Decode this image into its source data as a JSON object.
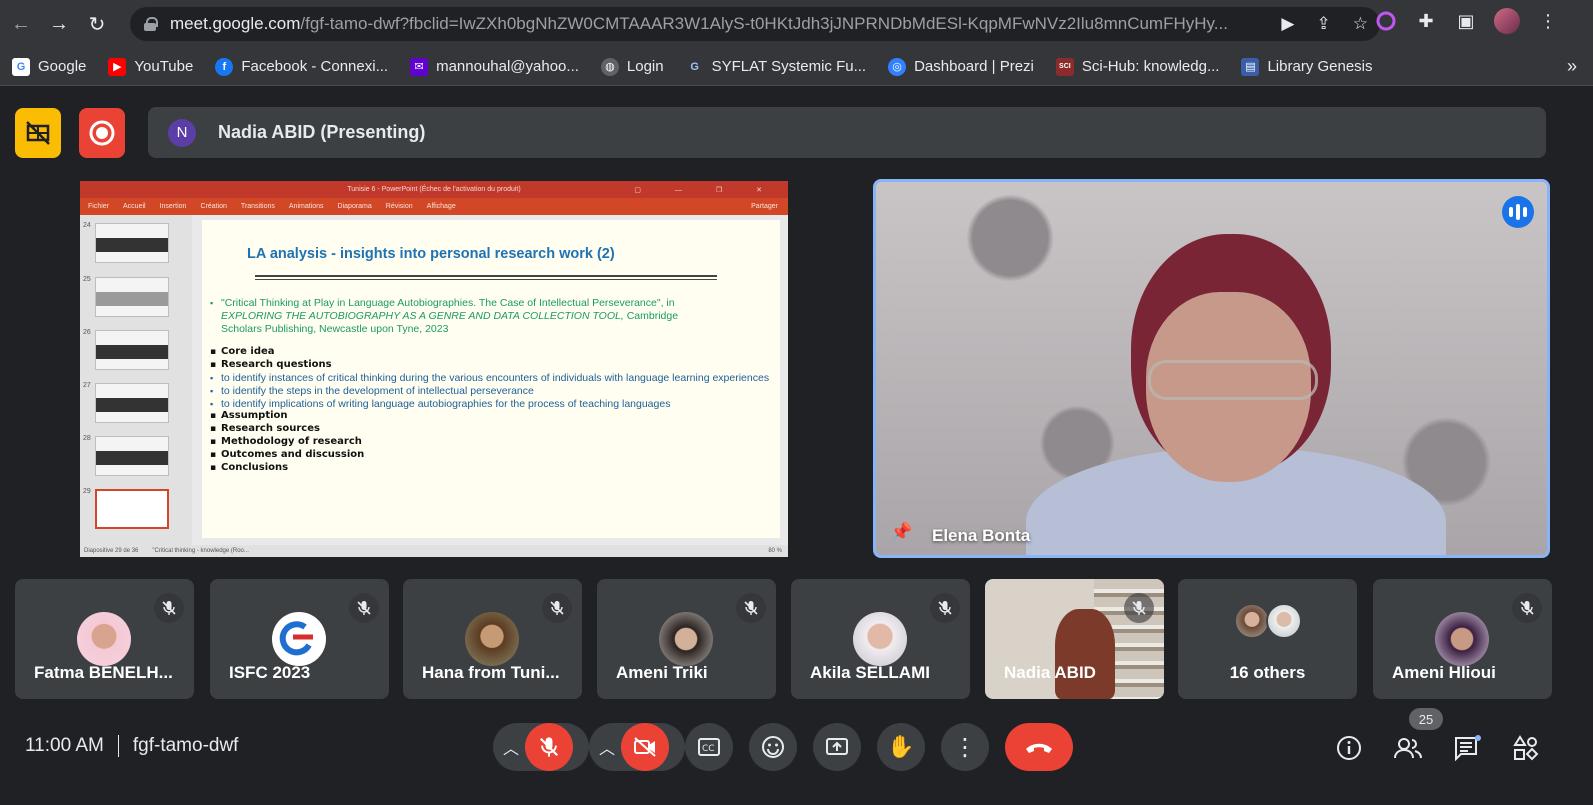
{
  "browser": {
    "url_host": "meet.google.com",
    "url_path": "/fgf-tamo-dwf?fbclid=IwZXh0bgNhZW0CMTAAAR3W1AlyS-t0HKtJdh3jJNPRNDbMdESl-KqpMFwNVz2Ilu8mnCumFHyHy...",
    "bookmarks": [
      {
        "label": "Google",
        "icon": "google-icon",
        "color": "#4285f4"
      },
      {
        "label": "YouTube",
        "icon": "youtube-icon",
        "color": "#ff0000"
      },
      {
        "label": "Facebook - Connexi...",
        "icon": "facebook-icon",
        "color": "#1877f2"
      },
      {
        "label": "mannouhal@yahoo...",
        "icon": "yahoo-mail-icon",
        "color": "#6001d2"
      },
      {
        "label": "Login",
        "icon": "globe-icon",
        "color": "#5f6368"
      },
      {
        "label": "SYFLAT Systemic Fu...",
        "icon": "syflat-icon",
        "color": "#5f6368"
      },
      {
        "label": "Dashboard | Prezi",
        "icon": "prezi-icon",
        "color": "#3181ff"
      },
      {
        "label": "Sci-Hub: knowledg...",
        "icon": "scihub-icon",
        "color": "#8b2b2b"
      },
      {
        "label": "Library Genesis",
        "icon": "library-icon",
        "color": "#3a5fa8"
      }
    ]
  },
  "meet": {
    "presenting_initial": "N",
    "presenting_label": "Nadia ABID (Presenting)",
    "speaker_name": "Elena Bonta",
    "meeting_code": "fgf-tamo-dwf",
    "time": "11:00 AM",
    "participant_count": "25",
    "participants": [
      {
        "name": "Fatma BENELH..."
      },
      {
        "name": "ISFC 2023"
      },
      {
        "name": "Hana from Tuni..."
      },
      {
        "name": "Ameni Triki"
      },
      {
        "name": "Akila SELLAMI"
      },
      {
        "name": "Nadia ABID"
      },
      {
        "name": "16 others"
      },
      {
        "name": "Ameni Hlioui"
      }
    ]
  },
  "slide": {
    "window_title": "Tunisie 6 - PowerPoint (Échec de l'activation du produit)",
    "ribbon_tabs": [
      "Fichier",
      "Accueil",
      "Insertion",
      "Création",
      "Transitions",
      "Animations",
      "Diaporama",
      "Révision",
      "Affichage"
    ],
    "share_label": "Partager",
    "thumb_numbers": [
      "24",
      "25",
      "26",
      "27",
      "28",
      "29"
    ],
    "title": "LA analysis  - insights into personal research work  (2)",
    "citation_line1": "\"Critical Thinking at Play in Language Autobiographies. The Case of Intellectual Perseverance\", in",
    "citation_line2": "EXPLORING THE AUTOBIOGRAPHY AS A GENRE AND DATA COLLECTION TOOL,",
    "citation_line2b": " Cambridge",
    "citation_line3": "Scholars Publishing, Newcastle upon Tyne, 2023",
    "core_idea": "Core idea",
    "research_questions": "Research questions",
    "q1": "to identify instances of critical thinking during the various encounters of individuals with language learning experiences",
    "q2": "to identify the steps in the development of intellectual perseverance",
    "q3": "to identify implications of writing language autobiographies for the process of teaching languages",
    "assumption": "Assumption",
    "sources": "Research sources",
    "methodology": "Methodology of research",
    "outcomes": "Outcomes and discussion",
    "conclusions": "Conclusions",
    "status_left": "Diapositive 29 de 36",
    "notes_text": "\"Critical thinking - knowledge (Roo...",
    "zoom": "80 %"
  }
}
